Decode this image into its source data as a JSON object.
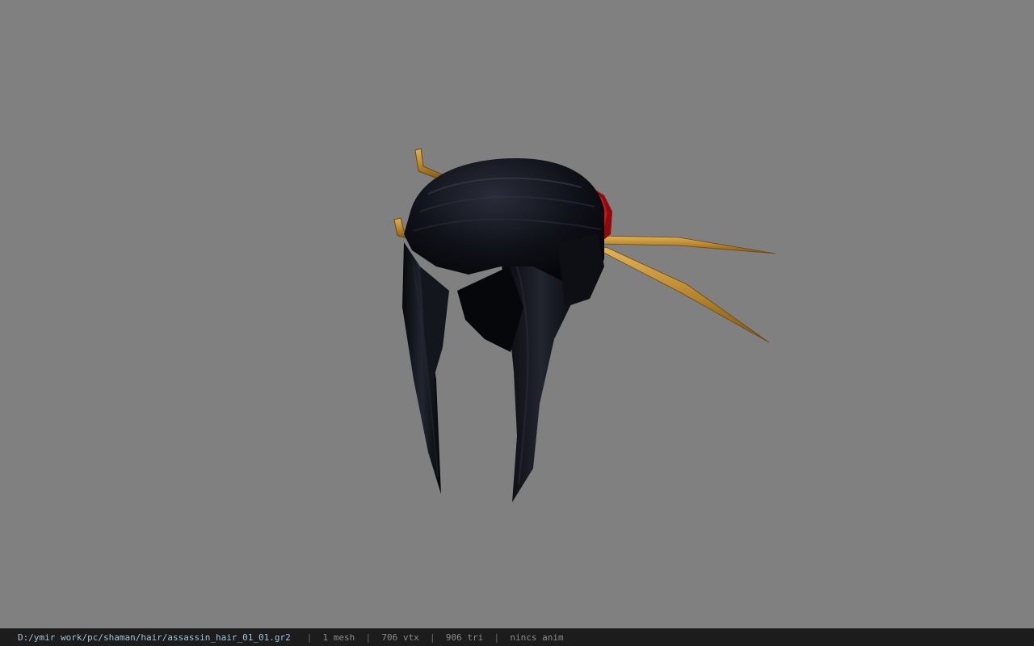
{
  "viewer": {
    "background_color": "#808080",
    "model_subject": "black hair bun with gold hairpins and red ornament"
  },
  "status_bar": {
    "file_path": "D:/ymir work/pc/shaman/hair/assassin_hair_01_01.gr2",
    "separator": "|",
    "mesh_count": "1 mesh",
    "vertex_count": "706 vtx",
    "triangle_count": "906 tri",
    "anim_status": "nincs anim"
  }
}
